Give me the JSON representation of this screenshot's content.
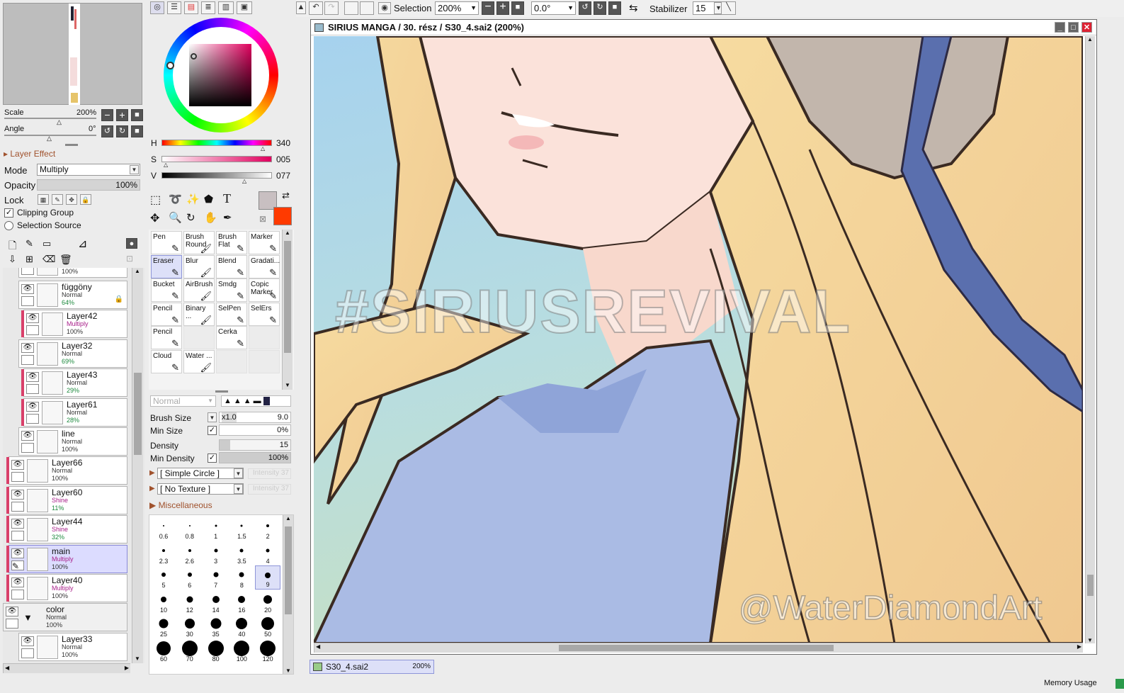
{
  "toolbar": {
    "selection_label": "Selection",
    "zoom": "200%",
    "angle": "0.0°",
    "stabilizer_label": "Stabilizer",
    "stabilizer_value": "15"
  },
  "navigator": {
    "scale_label": "Scale",
    "scale_value": "200%",
    "angle_label": "Angle",
    "angle_value": "0°"
  },
  "layer_panel": {
    "effect_label": "Layer Effect",
    "mode_label": "Mode",
    "mode_value": "Multiply",
    "opacity_label": "Opacity",
    "opacity_value": "100%",
    "lock_label": "Lock",
    "clipping_group": "Clipping Group",
    "selection_source": "Selection Source",
    "top_partial_opacity": "100%",
    "layers": [
      {
        "name": "függöny",
        "mode": "Normal",
        "opacity": "64%"
      },
      {
        "name": "Layer42",
        "mode": "Multiply",
        "opacity": "100%"
      },
      {
        "name": "Layer32",
        "mode": "Normal",
        "opacity": "69%"
      },
      {
        "name": "Layer43",
        "mode": "Normal",
        "opacity": "29%"
      },
      {
        "name": "Layer61",
        "mode": "Normal",
        "opacity": "28%"
      },
      {
        "name": "line",
        "mode": "Normal",
        "opacity": "100%"
      },
      {
        "name": "Layer66",
        "mode": "Normal",
        "opacity": "100%"
      },
      {
        "name": "Layer60",
        "mode": "Shine",
        "opacity": "11%"
      },
      {
        "name": "Layer44",
        "mode": "Shine",
        "opacity": "32%"
      },
      {
        "name": "main",
        "mode": "Multiply",
        "opacity": "100%"
      },
      {
        "name": "Layer40",
        "mode": "Multiply",
        "opacity": "100%"
      },
      {
        "name": "color",
        "mode": "Normal",
        "opacity": "100%"
      },
      {
        "name": "Layer33",
        "mode": "Normal",
        "opacity": "100%"
      }
    ]
  },
  "color": {
    "h_label": "H",
    "h_value": "340",
    "s_label": "S",
    "s_value": "005",
    "v_label": "V",
    "v_value": "077",
    "primary": "#c8bfc1",
    "secondary": "#ff3a00"
  },
  "brushes": [
    [
      "Pen",
      "Brush Round",
      "Brush Flat",
      "Marker"
    ],
    [
      "Eraser",
      "Blur",
      "Blend",
      "Gradati..."
    ],
    [
      "Bucket",
      "AirBrush",
      "Smdg",
      "Copic Marker"
    ],
    [
      "Pencil",
      "Binary ...",
      "SelPen",
      "SelErs"
    ],
    [
      "Pencil",
      "",
      "Cerka",
      ""
    ],
    [
      "Cloud",
      "Water ...",
      "",
      ""
    ]
  ],
  "brush_settings": {
    "blend_mode": "Normal",
    "size_label": "Brush Size",
    "size_mult": "x1.0",
    "size_value": "9.0",
    "min_size_label": "Min Size",
    "min_size_value": "0%",
    "density_label": "Density",
    "density_value": "15",
    "min_density_label": "Min Density",
    "min_density_value": "100%",
    "shape": "[ Simple Circle ]",
    "texture": "[ No Texture ]",
    "intensity_label": "Intensity 37",
    "misc_label": "Miscellaneous"
  },
  "brush_sizes": [
    "0.6",
    "0.8",
    "1",
    "1.5",
    "2",
    "2.3",
    "2.6",
    "3",
    "3.5",
    "4",
    "5",
    "6",
    "7",
    "8",
    "9",
    "10",
    "12",
    "14",
    "16",
    "20",
    "25",
    "30",
    "35",
    "40",
    "50",
    "60",
    "70",
    "80",
    "100",
    "120"
  ],
  "canvas": {
    "title": "SIRIUS MANGA / 30. rész / S30_4.sai2 (200%)",
    "watermark": "#SIRIUSREVIVAL",
    "signature": "@WaterDiamondArt"
  },
  "tab": {
    "name": "S30_4.sai2",
    "zoom": "200%"
  },
  "status": {
    "memory": "Memory Usage"
  }
}
